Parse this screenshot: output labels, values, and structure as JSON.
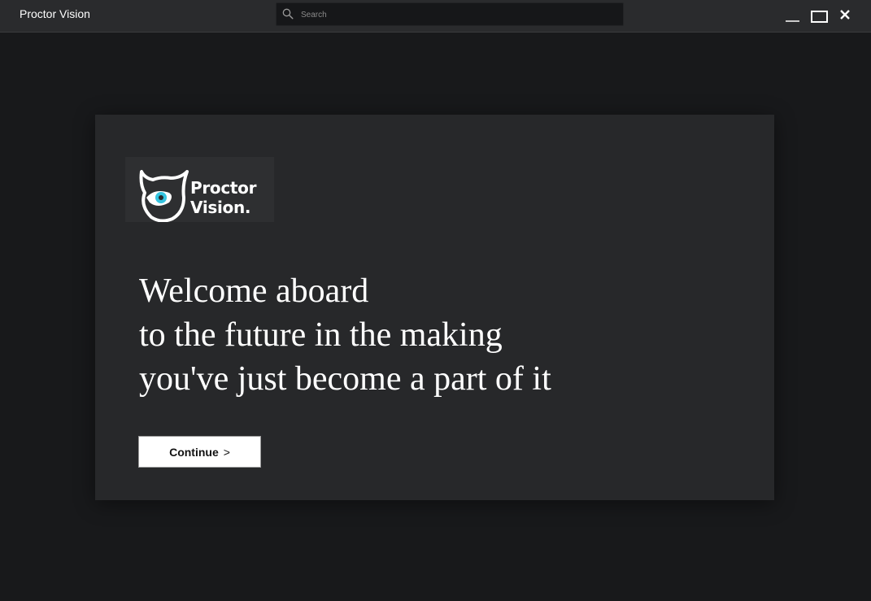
{
  "window": {
    "title": "Proctor Vision",
    "minimize_icon": "minimize-icon",
    "maximize_icon": "maximize-icon",
    "close_icon": "close-icon"
  },
  "search": {
    "placeholder": "Search",
    "value": "",
    "icon": "search-icon"
  },
  "logo": {
    "line1": "Proctor",
    "line2": "Vision.",
    "icon": "owl-logo-icon",
    "accent_color": "#35c4e0"
  },
  "welcome": {
    "line1": "Welcome aboard",
    "line2": "to the future in the making",
    "line3": "you've just become a part of it"
  },
  "continue_button": {
    "label": "Continue",
    "chevron": ">"
  },
  "colors": {
    "background": "#18191b",
    "titlebar": "#2a2b2d",
    "card": "#27282a",
    "text": "#ffffff"
  }
}
